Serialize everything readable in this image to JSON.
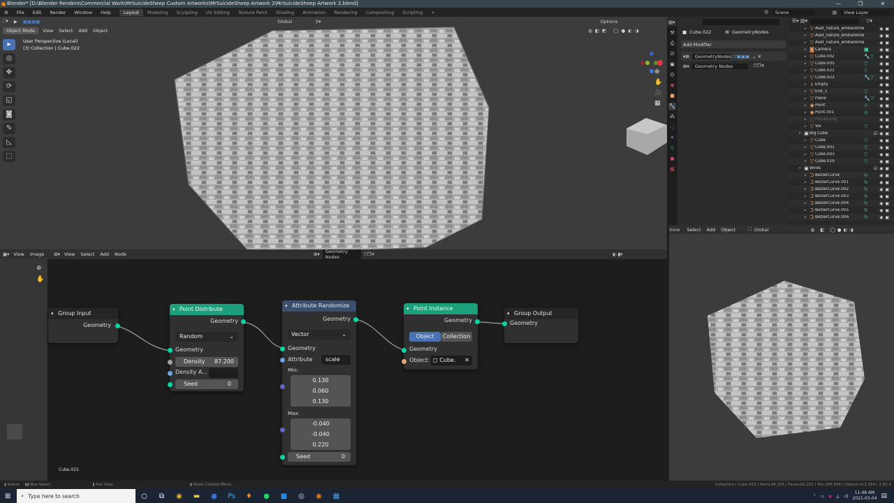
{
  "window": {
    "title": "Blender* [D:\\Blender Renders\\Commercial Work\\MrSuicideSheep Custom Artworks\\MrSuicideSheep Artwork 2\\MrSuicideSheep Artwork 2.blend]",
    "controls": [
      "—",
      "❐",
      "✕"
    ]
  },
  "menubar": {
    "menus": [
      "File",
      "Edit",
      "Render",
      "Window",
      "Help"
    ],
    "workspaces": [
      "Layout",
      "Modeling",
      "Sculpting",
      "UV Editing",
      "Texture Paint",
      "Shading",
      "Animation",
      "Rendering",
      "Compositing",
      "Scripting"
    ],
    "active_workspace": "Layout",
    "add_workspace": "+",
    "scene": "Scene",
    "view_layer": "View Layer"
  },
  "viewport": {
    "mode": "Object Mode",
    "menus": [
      "View",
      "Select",
      "Add",
      "Object"
    ],
    "transform_orientation": "Global",
    "options_label": "Options",
    "overlay_line1": "User Perspective (Local)",
    "overlay_line2": "(3) Collection | Cube.022",
    "tools": [
      "select-box",
      "cursor",
      "move",
      "rotate",
      "scale",
      "transform",
      "annotate",
      "measure",
      "add-cube"
    ]
  },
  "properties": {
    "object_name": "Cube.022",
    "modifier_data_name": "GeometryNodes",
    "add_modifier": "Add Modifier",
    "modifier_name": "GeometryNodes",
    "node_group": "Geometry Nodes"
  },
  "outliner": {
    "items": [
      {
        "name": "Aset_nature_embankment_",
        "type": "mesh",
        "mod": "",
        "depth": 1
      },
      {
        "name": "Aset_nature_embankment_",
        "type": "mesh",
        "mod": "",
        "depth": 1
      },
      {
        "name": "Aset_nature_embankment_",
        "type": "mesh",
        "mod": "",
        "depth": 1
      },
      {
        "name": "Camera",
        "type": "camera",
        "mod": "■",
        "depth": 1
      },
      {
        "name": "Cube.002",
        "type": "mesh",
        "mod": "🔧▽",
        "depth": 1
      },
      {
        "name": "Cube.005",
        "type": "mesh",
        "mod": "▽",
        "depth": 1
      },
      {
        "name": "Cube.021",
        "type": "mesh",
        "mod": "▽",
        "depth": 1
      },
      {
        "name": "Cube.022",
        "type": "mesh",
        "mod": "🔧▽",
        "depth": 1
      },
      {
        "name": "Empty",
        "type": "empty",
        "mod": "",
        "depth": 1
      },
      {
        "name": "Erik_1",
        "type": "mesh",
        "mod": "▽",
        "depth": 1
      },
      {
        "name": "Plane",
        "type": "mesh",
        "mod": "🔧▽",
        "depth": 1
      },
      {
        "name": "Point",
        "type": "light",
        "mod": "☼",
        "depth": 1
      },
      {
        "name": "Point.001",
        "type": "light",
        "mod": "◎",
        "depth": 1
      },
      {
        "name": "Processing",
        "type": "hidden",
        "mod": "",
        "depth": 1
      },
      {
        "name": "Vol",
        "type": "mesh",
        "mod": "▽",
        "depth": 1
      },
      {
        "name": "Big Cube",
        "type": "collection",
        "mod": "",
        "depth": 0
      },
      {
        "name": "Cube",
        "type": "mesh",
        "mod": "▽",
        "depth": 1
      },
      {
        "name": "Cube.001",
        "type": "mesh",
        "mod": "▽",
        "depth": 1
      },
      {
        "name": "Cube.003",
        "type": "mesh",
        "mod": "▽",
        "depth": 1
      },
      {
        "name": "Cube.019",
        "type": "mesh",
        "mod": "▽",
        "depth": 1
      },
      {
        "name": "Wires",
        "type": "collection",
        "mod": "",
        "depth": 0
      },
      {
        "name": "BezierCurve",
        "type": "curve",
        "mod": "↻",
        "depth": 1
      },
      {
        "name": "BezierCurve.001",
        "type": "curve",
        "mod": "↻",
        "depth": 1
      },
      {
        "name": "BezierCurve.002",
        "type": "curve",
        "mod": "↻",
        "depth": 1
      },
      {
        "name": "BezierCurve.003",
        "type": "curve",
        "mod": "↻",
        "depth": 1
      },
      {
        "name": "BezierCurve.004",
        "type": "curve",
        "mod": "↻",
        "depth": 1
      },
      {
        "name": "BezierCurve.005",
        "type": "curve",
        "mod": "↻",
        "depth": 1
      },
      {
        "name": "BezierCurve.006",
        "type": "curve",
        "mod": "↻",
        "depth": 1
      }
    ]
  },
  "viewport2": {
    "menus": [
      "View",
      "Select",
      "Add",
      "Object"
    ],
    "transform_orientation": "Global"
  },
  "node_editor": {
    "image_menus": [
      "View",
      "Image"
    ],
    "menus": [
      "View",
      "Select",
      "Add",
      "Node"
    ],
    "node_tree": "Geometry Nodes",
    "footer_label": "Cube.022",
    "nodes": {
      "group_input": {
        "title": "Group Input",
        "output": "Geometry"
      },
      "point_distribute": {
        "title": "Point Distribute",
        "output": "Geometry",
        "mode": "Random",
        "input_geometry": "Geometry",
        "density_label": "Density",
        "density_value": "87.200",
        "density_attr_label": "Density A...",
        "seed_label": "Seed",
        "seed_value": "0"
      },
      "attribute_randomize": {
        "title": "Attribute Randomize",
        "output": "Geometry",
        "type": "Vector",
        "input_geometry": "Geometry",
        "attribute_label": "Attribute",
        "attribute_value": "scale",
        "min_label": "Min:",
        "min": [
          "0.130",
          "0.060",
          "0.130"
        ],
        "max_label": "Max:",
        "max": [
          "-0.040",
          "-0.040",
          "0.220"
        ],
        "seed_label": "Seed",
        "seed_value": "0"
      },
      "point_instance": {
        "title": "Point Instance",
        "output": "Geometry",
        "tab_object": "Object",
        "tab_collection": "Collection",
        "input_geometry": "Geometry",
        "object_label": "Object:",
        "object_value": "Cube."
      },
      "group_output": {
        "title": "Group Output",
        "input": "Geometry"
      }
    }
  },
  "statusbar": {
    "hints": [
      "Select",
      "Box Select",
      "Pan View",
      "Node Context Menu"
    ],
    "stats": "Collection | Cube.022 | Verts:94,355 | Faces:92,202 | Tris:185,856 | Objects:0/1,354 | 2.92.0"
  },
  "taskbar": {
    "search_placeholder": "Type here to search",
    "time": "11:48 AM",
    "date": "2021-03-04"
  },
  "colors": {
    "accent_blue": "#4772b3",
    "geometry_node_header": "#1e9f7b",
    "attribute_node_header": "#3b4e6e",
    "geometry_socket": "#00d6a3"
  }
}
